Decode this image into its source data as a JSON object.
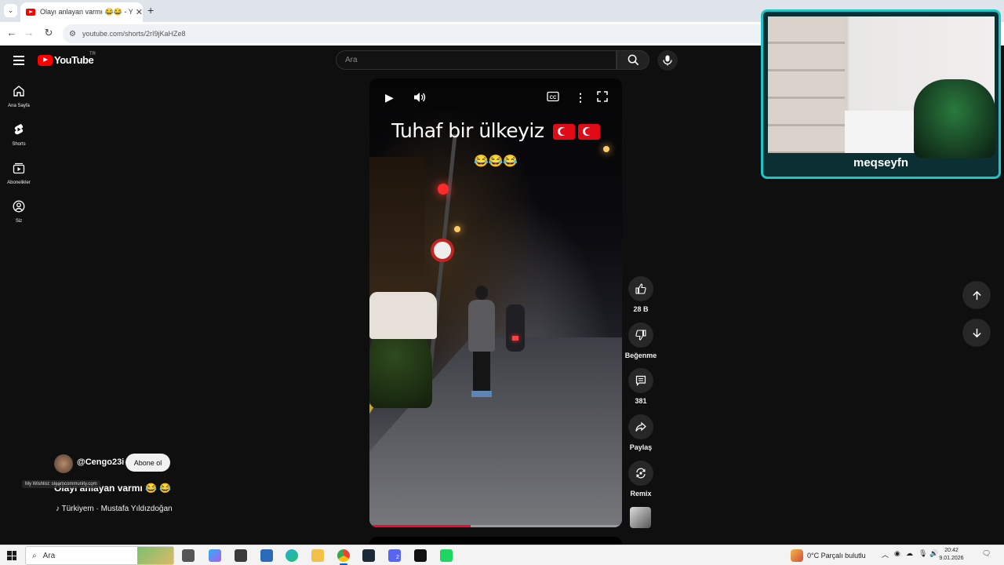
{
  "browser": {
    "tab_title": "Olayı anlayan varmı 😂😂 - YouTube",
    "new_tab": "+",
    "url": "youtube.com/shorts/2rI9jKaHZe8"
  },
  "youtube": {
    "logo_text": "YouTube",
    "country_code": "TR",
    "search_placeholder": "Ara",
    "sidebar": [
      {
        "label": "Ana Sayfa"
      },
      {
        "label": "Shorts"
      },
      {
        "label": "Abonelikler"
      },
      {
        "label": "Siz"
      }
    ],
    "video": {
      "overlay_text": "Tuhaf bir ülkeyiz",
      "overlay_emojis": "😂😂😂",
      "progress": 0.4
    },
    "actions": {
      "like_count": "28 B",
      "dislike_label": "Beğenme",
      "comments_count": "381",
      "share_label": "Paylaş",
      "remix_label": "Remix"
    },
    "channel": {
      "handle": "@Cengo23i",
      "subscribe_label": "Abone ol",
      "video_title": "Olayı anlayan varmı 😂 😂",
      "wishlist_overlay": "My Wishlist: steamcommunity.com",
      "music": "Türkiyem · Mustafa Yıldızdoğan"
    }
  },
  "stream_overlay": {
    "streamer_name": "meqseyfn"
  },
  "taskbar": {
    "search_placeholder": "Ara",
    "weather": "0°C  Parçalı bulutlu",
    "time": "20:42",
    "date": "9.01.2026",
    "notification_badge": "2"
  },
  "colors": {
    "yt_bg": "#0f0f0f",
    "yt_red": "#ff0000",
    "progress_red": "#ff0033",
    "stream_frame": "#1bc5c8"
  }
}
